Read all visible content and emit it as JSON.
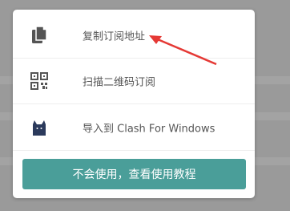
{
  "menu": {
    "items": [
      {
        "label": "复制订阅地址",
        "icon": "copy-icon"
      },
      {
        "label": "扫描二维码订阅",
        "icon": "qr-code-icon"
      },
      {
        "label": "导入到 Clash For Windows",
        "icon": "clash-cat-icon"
      }
    ]
  },
  "help_button": {
    "label": "不会使用，查看使用教程"
  },
  "colors": {
    "accent": "#4a9e99",
    "annotation_arrow": "#e53935",
    "icon_dark": "#555555",
    "clash_icon": "#2b3a5c"
  }
}
